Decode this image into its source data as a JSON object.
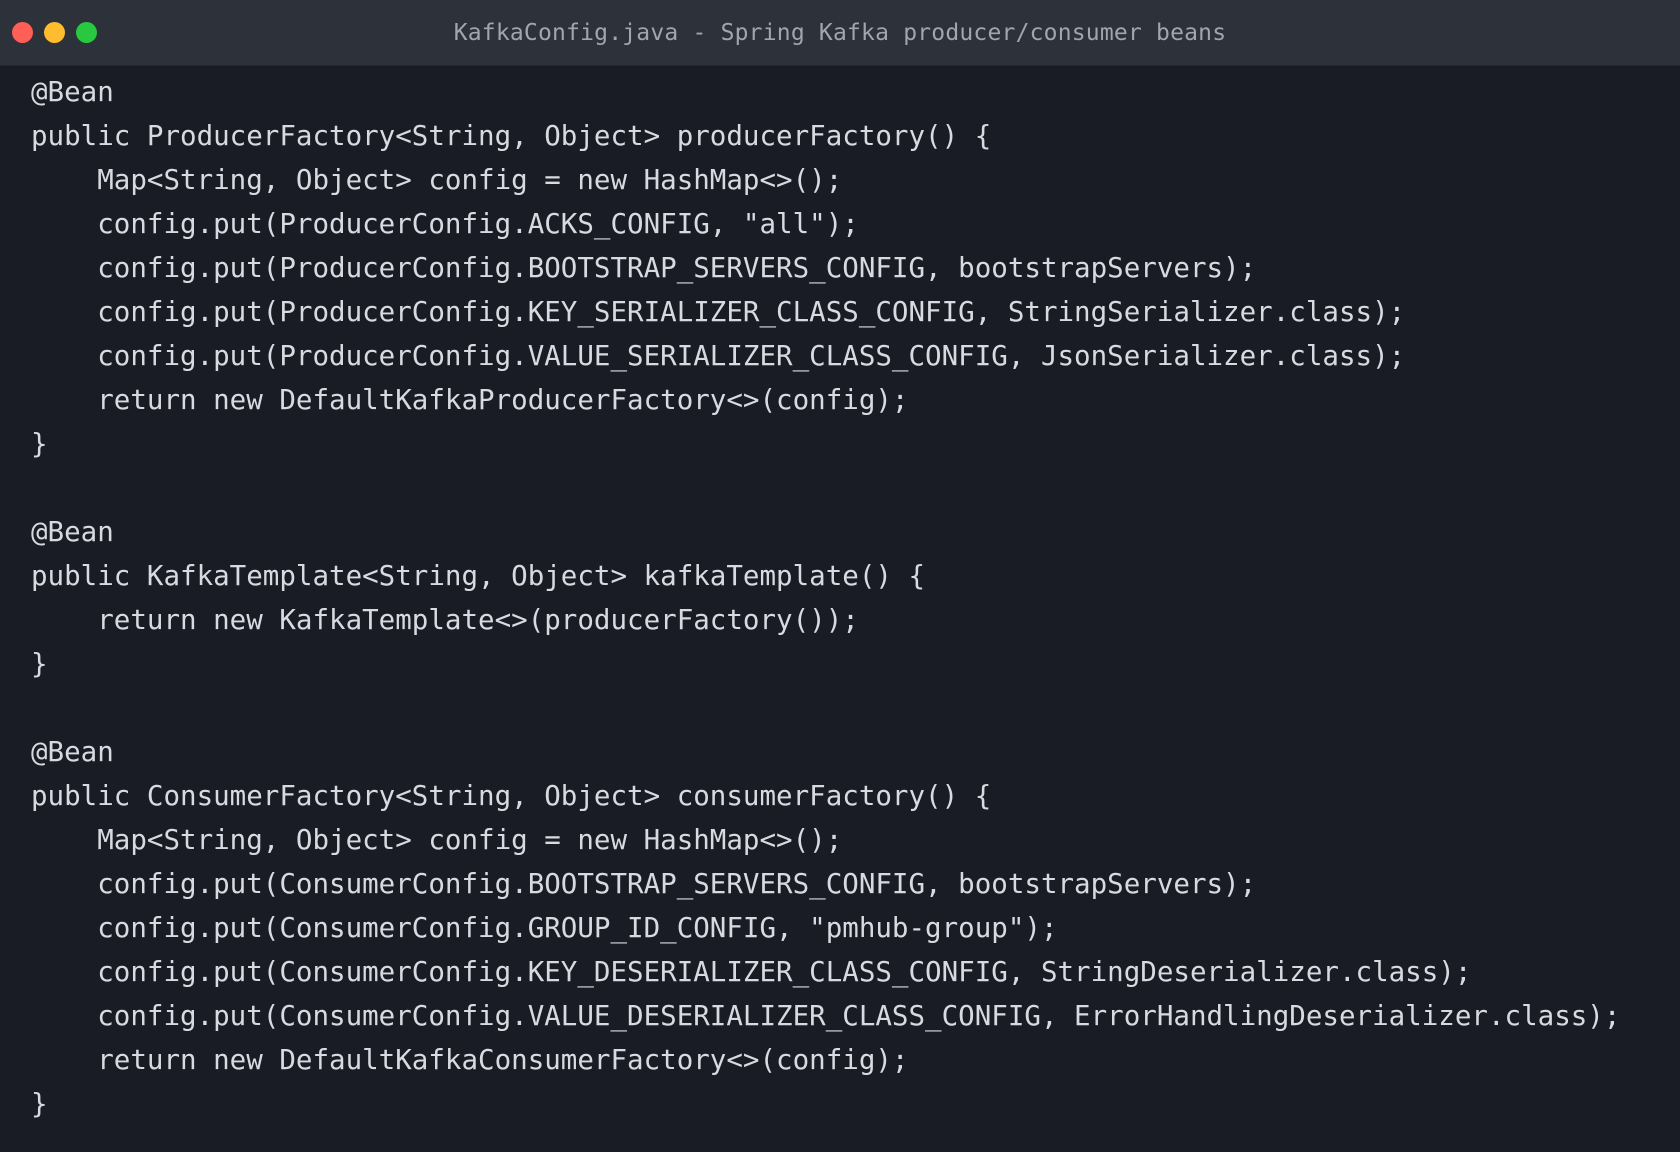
{
  "window": {
    "title": "KafkaConfig.java - Spring Kafka producer/consumer beans",
    "buttons": [
      {
        "name": "close-button",
        "color": "#ff5f57"
      },
      {
        "name": "minimize-button",
        "color": "#febc2e"
      },
      {
        "name": "maximize-button",
        "color": "#28c840"
      }
    ]
  },
  "colors": {
    "background": "#191c25",
    "titlebar": "#2c313a",
    "code_text": "#d7dae0"
  },
  "code": {
    "lines": [
      "@Bean",
      "public ProducerFactory<String, Object> producerFactory() {",
      "    Map<String, Object> config = new HashMap<>();",
      "    config.put(ProducerConfig.ACKS_CONFIG, \"all\");",
      "    config.put(ProducerConfig.BOOTSTRAP_SERVERS_CONFIG, bootstrapServers);",
      "    config.put(ProducerConfig.KEY_SERIALIZER_CLASS_CONFIG, StringSerializer.class);",
      "    config.put(ProducerConfig.VALUE_SERIALIZER_CLASS_CONFIG, JsonSerializer.class);",
      "    return new DefaultKafkaProducerFactory<>(config);",
      "}",
      "",
      "@Bean",
      "public KafkaTemplate<String, Object> kafkaTemplate() {",
      "    return new KafkaTemplate<>(producerFactory());",
      "}",
      "",
      "@Bean",
      "public ConsumerFactory<String, Object> consumerFactory() {",
      "    Map<String, Object> config = new HashMap<>();",
      "    config.put(ConsumerConfig.BOOTSTRAP_SERVERS_CONFIG, bootstrapServers);",
      "    config.put(ConsumerConfig.GROUP_ID_CONFIG, \"pmhub-group\");",
      "    config.put(ConsumerConfig.KEY_DESERIALIZER_CLASS_CONFIG, StringDeserializer.class);",
      "    config.put(ConsumerConfig.VALUE_DESERIALIZER_CLASS_CONFIG, ErrorHandlingDeserializer.class);",
      "    return new DefaultKafkaConsumerFactory<>(config);",
      "}"
    ]
  }
}
